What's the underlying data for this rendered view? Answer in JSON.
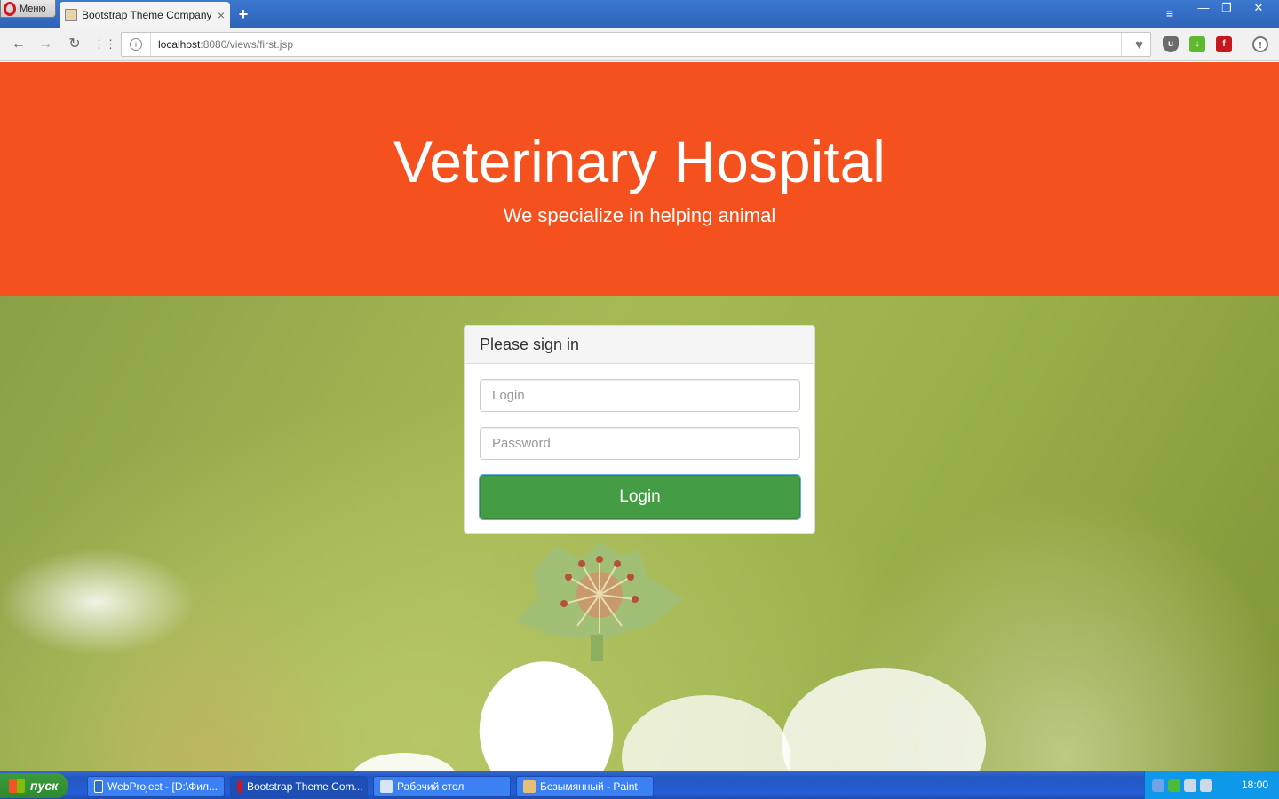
{
  "browser": {
    "menu_label": "Меню",
    "tab_title": "Bootstrap Theme Company",
    "tab_close": "×",
    "new_tab": "+",
    "address_host": "localhost",
    "address_path": ":8080/views/first.jsp"
  },
  "page": {
    "title": "Veterinary Hospital",
    "subtitle": "We specialize in helping animal",
    "hero_color": "#f4511e"
  },
  "signin": {
    "heading": "Please sign in",
    "login_placeholder": "Login",
    "password_placeholder": "Password",
    "submit_label": "Login",
    "button_color": "#449d44"
  },
  "taskbar": {
    "start_label": "пуск",
    "tasks": [
      {
        "label": "WebProject - [D:\\Фил..."
      },
      {
        "label": "Bootstrap Theme Com..."
      },
      {
        "label": "Рабочий стол"
      },
      {
        "label": "Безымянный - Paint"
      }
    ],
    "clock": "18:00"
  },
  "icons": [
    "opera-icon",
    "page-favicon",
    "back-arrow-icon",
    "forward-arrow-icon",
    "reload-icon",
    "speed-dial-icon",
    "site-info-icon",
    "heart-icon",
    "ublock-icon",
    "download-icon",
    "flash-icon",
    "update-icon"
  ]
}
